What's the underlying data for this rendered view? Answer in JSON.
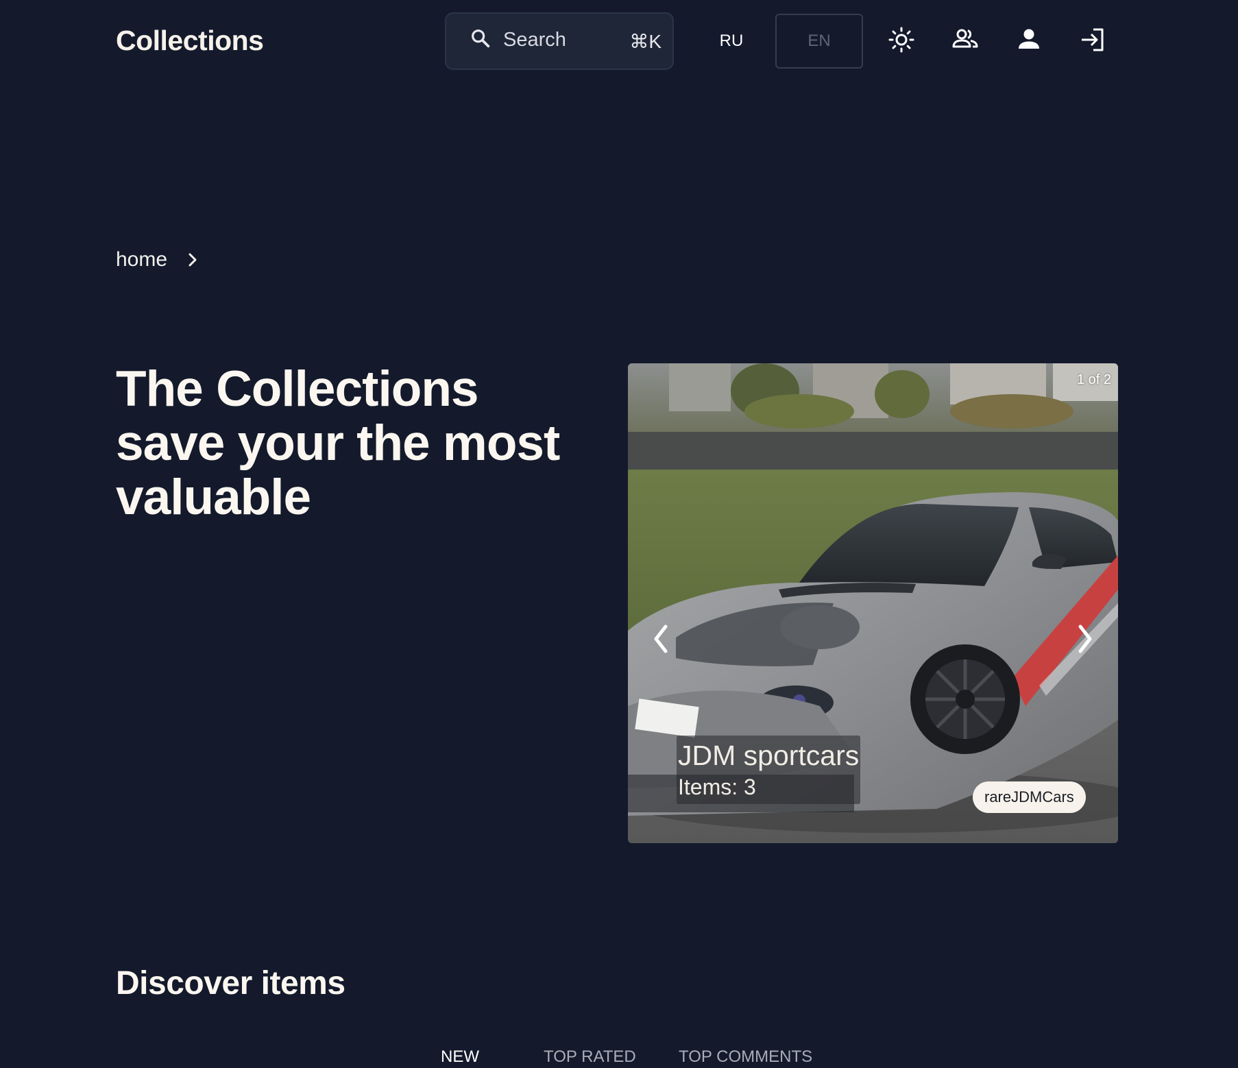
{
  "header": {
    "logo": "Collections",
    "search": {
      "label": "Search",
      "shortcut": "⌘K"
    },
    "languages": {
      "ru": "RU",
      "en": "EN"
    },
    "icons": [
      "sun-icon",
      "users-icon",
      "profile-icon",
      "login-icon"
    ]
  },
  "breadcrumb": {
    "items": [
      "home"
    ]
  },
  "hero": {
    "title": "The Collections save your the most valuable"
  },
  "carousel": {
    "counter": "1 of 2",
    "slide": {
      "title": "JDM sportcars",
      "items_count": "Items: 3",
      "tag": "rareJDMCars",
      "image": "silver-sportscar-photo"
    }
  },
  "discover": {
    "title": "Discover items",
    "tabs": [
      {
        "label": "NEW",
        "active": true
      },
      {
        "label": "TOP RATED",
        "active": false
      },
      {
        "label": "TOP COMMENTS",
        "active": false
      }
    ]
  },
  "colors": {
    "background": "#141a2c",
    "text": "#f6f1ea",
    "search_bg": "#1f2638",
    "chip_bg": "#f7f3ec"
  }
}
